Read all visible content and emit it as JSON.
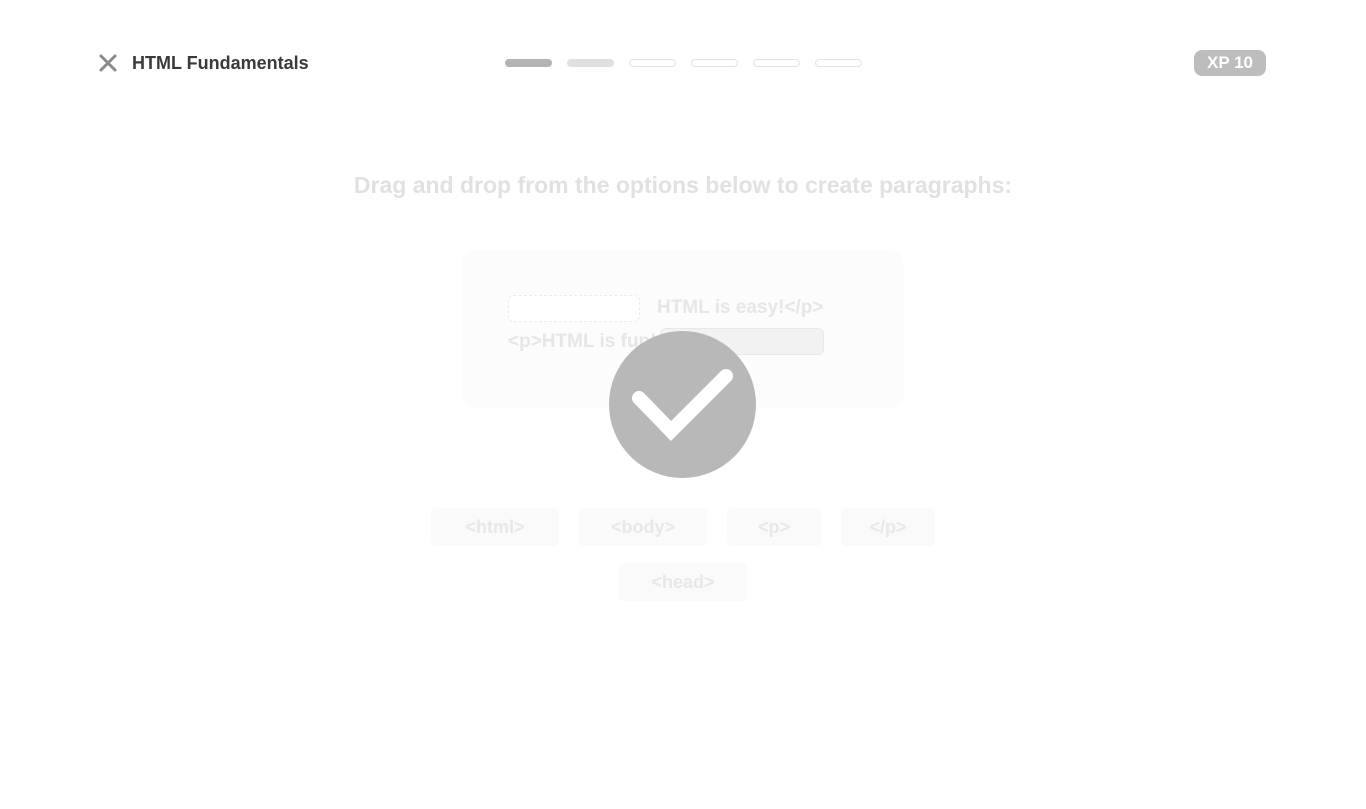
{
  "header": {
    "close_icon": "close-icon",
    "title": "HTML Fundamentals",
    "progress": {
      "total": 6,
      "completed": 1,
      "current": 2
    },
    "xp_label": "XP 10"
  },
  "exercise": {
    "prompt": "Drag and drop from the options below to create paragraphs:",
    "code_lines": [
      {
        "after_slot": "HTML is easy!</p>"
      },
      {
        "before_slot": "<p>HTML is fun!"
      }
    ],
    "options": [
      "<html>",
      "<body>",
      "<p>",
      "</p>",
      "<head>"
    ]
  },
  "overlay": {
    "icon": "checkmark-icon",
    "colors": {
      "circle": "#b8b8b8",
      "check": "#ffffff"
    }
  },
  "colors": {
    "xp_badge": "#bdbdbd",
    "progress_done": "#b3b3b3",
    "progress_active": "#e0e0e0"
  }
}
